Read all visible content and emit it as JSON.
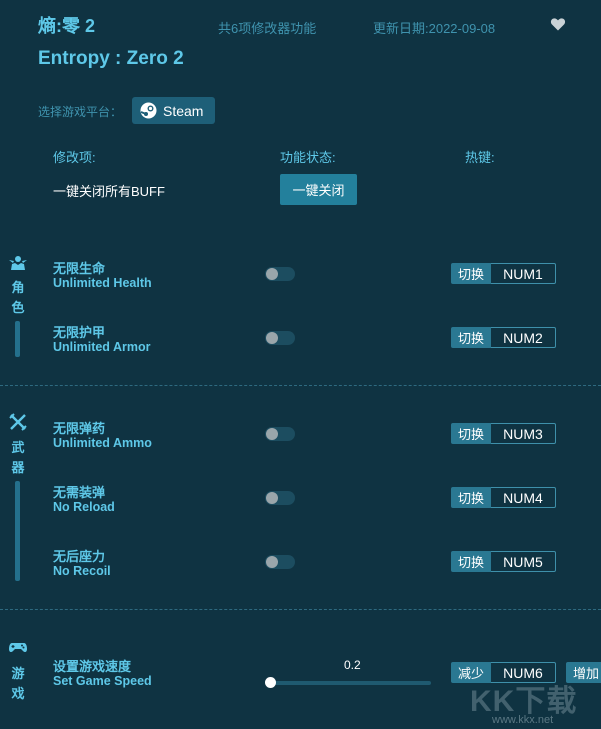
{
  "header": {
    "title_cn": "熵:零 2",
    "features_count": "共6项修改器功能",
    "update_date": "更新日期:2022-09-08",
    "title_en": "Entropy : Zero 2"
  },
  "platform": {
    "label": "选择游戏平台：",
    "selected": "Steam"
  },
  "table_headers": {
    "item": "修改项:",
    "status": "功能状态:",
    "hotkey": "热键:"
  },
  "close_all": {
    "label": "一键关闭所有BUFF",
    "button": "一键关闭"
  },
  "categories": [
    {
      "label": "角色",
      "icon": "character-icon"
    },
    {
      "label": "武器",
      "icon": "weapon-icon"
    },
    {
      "label": "游戏",
      "icon": "gamepad-icon"
    }
  ],
  "items": [
    {
      "name_cn": "无限生命",
      "name_en": "Unlimited Health",
      "toggle_label": "切换",
      "key": "NUM1",
      "enabled": false
    },
    {
      "name_cn": "无限护甲",
      "name_en": "Unlimited Armor",
      "toggle_label": "切换",
      "key": "NUM2",
      "enabled": false
    },
    {
      "name_cn": "无限弹药",
      "name_en": "Unlimited Ammo",
      "toggle_label": "切换",
      "key": "NUM3",
      "enabled": false
    },
    {
      "name_cn": "无需装弹",
      "name_en": "No Reload",
      "toggle_label": "切换",
      "key": "NUM4",
      "enabled": false
    },
    {
      "name_cn": "无后座力",
      "name_en": "No Recoil",
      "toggle_label": "切换",
      "key": "NUM5",
      "enabled": false
    }
  ],
  "speed": {
    "name_cn": "设置游戏速度",
    "name_en": "Set Game Speed",
    "value": "0.2",
    "decrease_label": "减少",
    "key": "NUM6",
    "increase_label": "增加"
  },
  "watermark": {
    "text": "KK下载",
    "url": "www.kkx.net"
  }
}
